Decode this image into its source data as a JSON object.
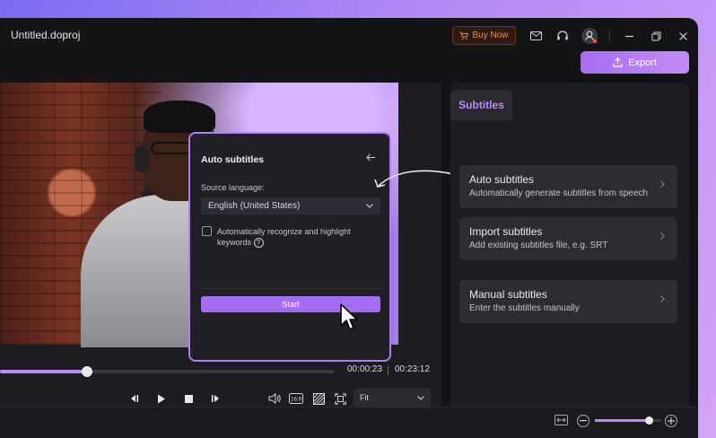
{
  "window": {
    "title": "Untitled.doproj"
  },
  "toolbar": {
    "buy_now_label": "Buy Now",
    "export_label": "Export",
    "icons": [
      "cart-icon",
      "mail-icon",
      "headset-icon",
      "user-icon",
      "minimize-icon",
      "restore-icon",
      "close-icon"
    ]
  },
  "player": {
    "current_time": "00:00:23",
    "total_time": "00:23:12",
    "progress": 0.26,
    "fit_option": "Fit",
    "aspect_label": "16:9"
  },
  "popup": {
    "title": "Auto subtitles",
    "source_language_label": "Source language:",
    "source_language_value": "English (United States)",
    "checkbox_label": "Automatically recognize and highlight keywords",
    "checkbox_checked": false,
    "help_glyph": "?",
    "start_label": "Start"
  },
  "panel": {
    "tab_label": "Subtitles",
    "options": [
      {
        "title": "Auto subtitles",
        "description": "Automatically generate subtitles from speech"
      },
      {
        "title": "Import subtitles",
        "description": "Add existing subtitles file, e.g. SRT"
      },
      {
        "title": "Manual subtitles",
        "description": "Enter the subtitles manually"
      }
    ]
  },
  "zoom": {
    "level": 0.82
  },
  "colors": {
    "accent": "#b47cf5",
    "buy_now": "#ff8a3d",
    "background": "#141417"
  }
}
